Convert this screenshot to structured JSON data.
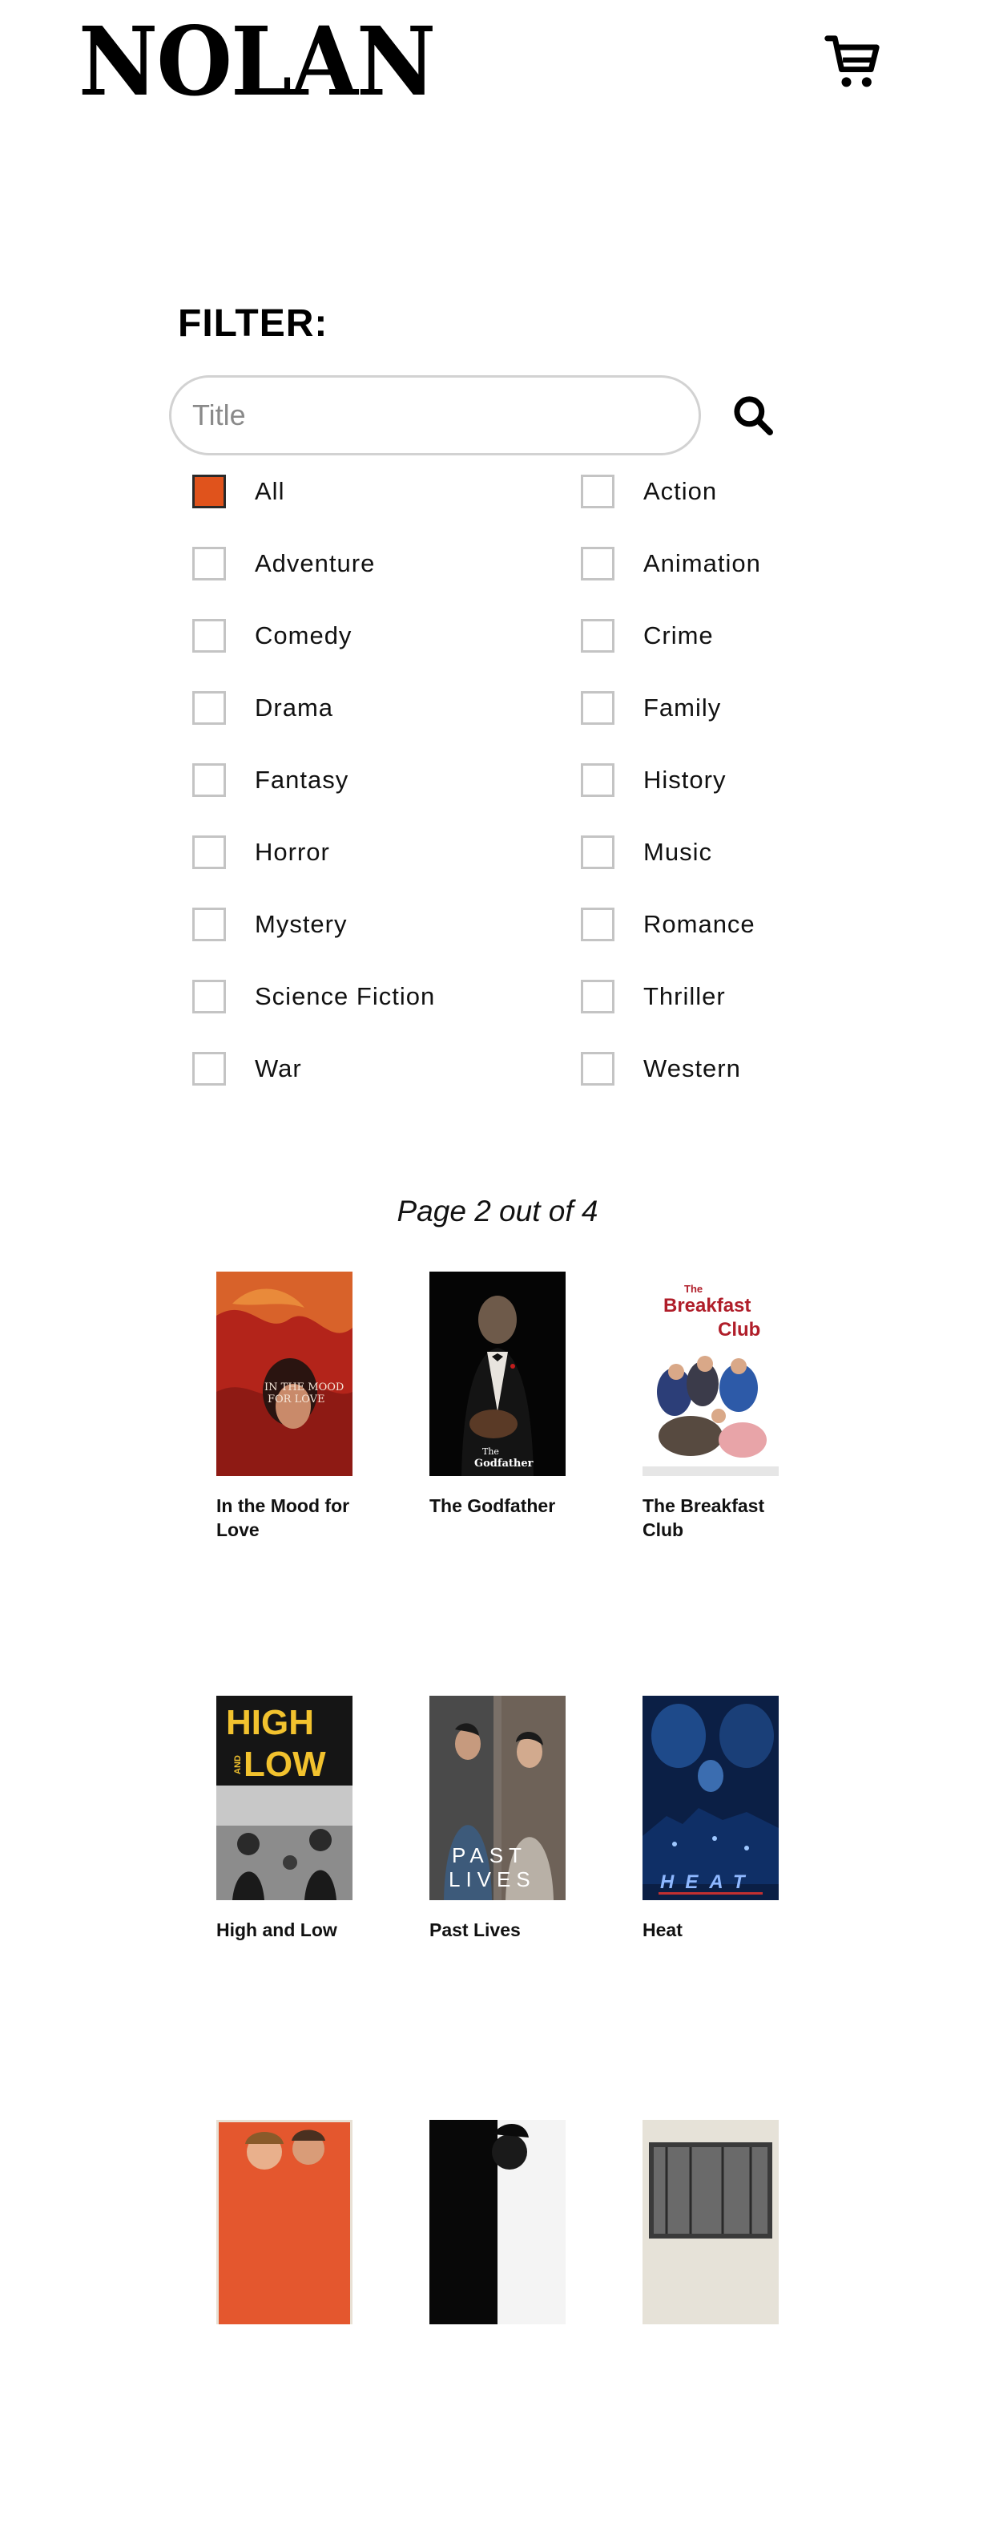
{
  "header": {
    "logo": "NOLAN"
  },
  "filter": {
    "title": "FILTER:",
    "search_placeholder": "Title",
    "search_value": "",
    "genres": [
      {
        "label": "All",
        "checked": true
      },
      {
        "label": "Action",
        "checked": false
      },
      {
        "label": "Adventure",
        "checked": false
      },
      {
        "label": "Animation",
        "checked": false
      },
      {
        "label": "Comedy",
        "checked": false
      },
      {
        "label": "Crime",
        "checked": false
      },
      {
        "label": "Drama",
        "checked": false
      },
      {
        "label": "Family",
        "checked": false
      },
      {
        "label": "Fantasy",
        "checked": false
      },
      {
        "label": "History",
        "checked": false
      },
      {
        "label": "Horror",
        "checked": false
      },
      {
        "label": "Music",
        "checked": false
      },
      {
        "label": "Mystery",
        "checked": false
      },
      {
        "label": "Romance",
        "checked": false
      },
      {
        "label": "Science Fiction",
        "checked": false
      },
      {
        "label": "Thriller",
        "checked": false
      },
      {
        "label": "War",
        "checked": false
      },
      {
        "label": "Western",
        "checked": false
      }
    ]
  },
  "pagination": {
    "text": "Page 2 out of 4"
  },
  "movies": [
    {
      "title": "In the Mood for Love"
    },
    {
      "title": "The Godfather"
    },
    {
      "title": "The Breakfast Club"
    },
    {
      "title": "High and Low"
    },
    {
      "title": "Past Lives"
    },
    {
      "title": "Heat"
    },
    {
      "title": ""
    },
    {
      "title": ""
    },
    {
      "title": ""
    }
  ],
  "posters": {
    "mood": {
      "line1": "IN THE MOOD",
      "line2": "FOR LOVE"
    },
    "godfather": {
      "line1": "The",
      "line2": "Godfather"
    },
    "breakfast": {
      "line1": "The",
      "line2": "Breakfast",
      "line3": "Club"
    },
    "highlow": {
      "line1": "HIGH",
      "line2": "AND",
      "line3": "LOW"
    },
    "pastlives": {
      "line1": "PAST",
      "line2": "LIVES"
    },
    "heat": {
      "line1": "HEAT"
    }
  },
  "colors": {
    "accent": "#e0531c",
    "checkbox_border": "#c4c4c4",
    "input_border": "#d2d2d2"
  },
  "icons": {
    "cart": "shopping-cart-icon",
    "search": "magnifier-icon"
  }
}
